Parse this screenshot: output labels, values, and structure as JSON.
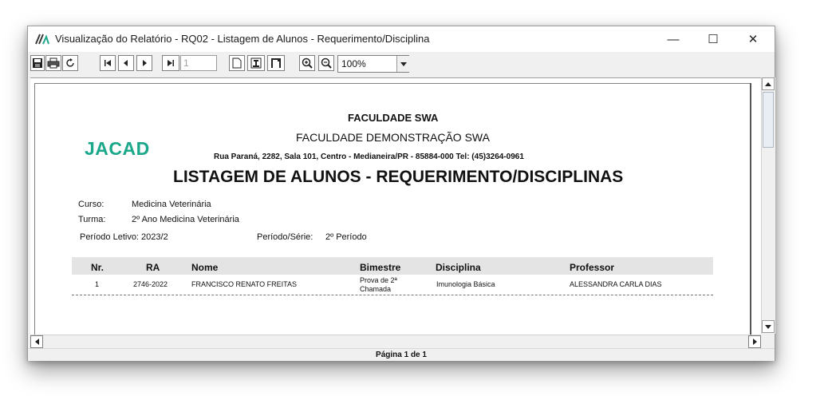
{
  "window": {
    "title": "Visualização do Relatório - RQ02 - Listagem de Alunos - Requerimento/Disciplina",
    "minimize_glyph": "—",
    "maximize_glyph": "☐",
    "close_glyph": "✕"
  },
  "toolbar": {
    "page_number": "1",
    "zoom_value": "100%",
    "icons": [
      "save-icon",
      "print-icon",
      "refresh-icon",
      "first-page-icon",
      "prev-page-icon",
      "next-page-icon",
      "last-page-icon",
      "page-width-icon",
      "one-page-icon",
      "two-pages-icon",
      "zoom-in-icon",
      "zoom-out-icon"
    ]
  },
  "report": {
    "logo": "JACAD",
    "institution": "FACULDADE SWA",
    "institution_full": "FACULDADE DEMONSTRAÇÃO SWA",
    "address": "Rua Paraná, 2282, Sala 101, Centro - Medianeira/PR - 85884-000 Tel: (45)3264-0961",
    "title": "LISTAGEM DE ALUNOS - REQUERIMENTO/DISCIPLINAS",
    "curso_label": "Curso:",
    "curso_value": "Medicina Veterinária",
    "turma_label": "Turma:",
    "turma_value": "2º Ano Medicina Veterinária",
    "periodo_letivo": "Período Letivo:  2023/2",
    "periodo_serie_label": "Período/Série:",
    "periodo_serie_value": "2º Período",
    "columns": [
      "Nr.",
      "RA",
      "Nome",
      "Bimestre",
      "Disciplina",
      "Professor"
    ],
    "rows": [
      {
        "nr": "1",
        "ra": "2746-2022",
        "nome": "FRANCISCO RENATO FREITAS",
        "bimestre_line1": "Prova de 2ª",
        "bimestre_line2": "Chamada",
        "disciplina": "Imunologia Básica",
        "professor": "ALESSANDRA CARLA DIAS"
      }
    ]
  },
  "status": {
    "page_label": "Página 1 de 1"
  },
  "colors": {
    "logo": "#1aa78a",
    "header_band": "#e4e4e4"
  }
}
